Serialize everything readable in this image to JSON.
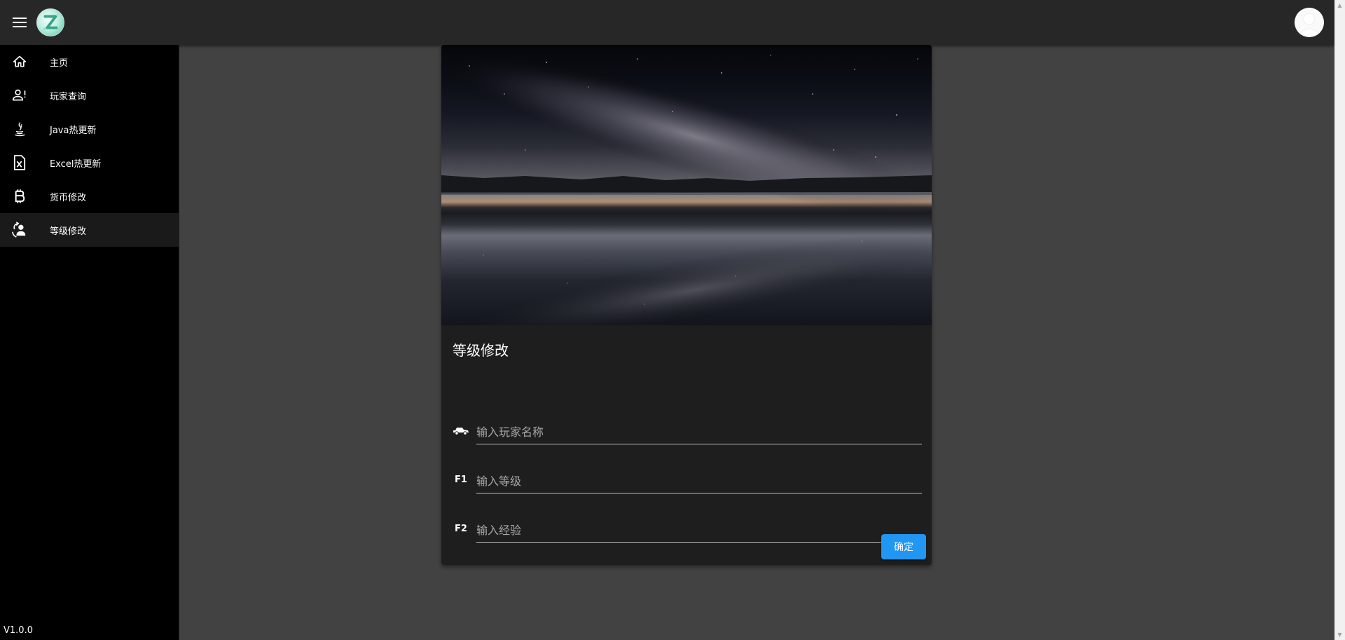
{
  "header": {
    "menu_icon": "hamburger-menu-icon",
    "logo_icon": "app-logo",
    "avatar_icon": "user-avatar"
  },
  "sidebar": {
    "items": [
      {
        "label": "主页",
        "icon": "home-icon"
      },
      {
        "label": "玩家查询",
        "icon": "account-alert-icon"
      },
      {
        "label": "Java热更新",
        "icon": "java-icon"
      },
      {
        "label": "Excel热更新",
        "icon": "excel-file-icon"
      },
      {
        "label": "货币修改",
        "icon": "bitcoin-icon"
      },
      {
        "label": "等级修改",
        "icon": "account-convert-icon"
      }
    ],
    "active_index": 5,
    "version": "V1.0.0"
  },
  "card": {
    "title": "等级修改",
    "fields": [
      {
        "icon": "car-icon",
        "icon_text": "",
        "placeholder": "输入玩家名称"
      },
      {
        "icon": "f1-key-icon",
        "icon_text": "F1",
        "placeholder": "输入等级"
      },
      {
        "icon": "f2-key-icon",
        "icon_text": "F2",
        "placeholder": "输入经验"
      }
    ],
    "confirm_label": "确定"
  },
  "colors": {
    "appbar": "#272727",
    "sidebar": "#000000",
    "background": "#424242",
    "card": "#1e1e1e",
    "primary": "#2196f3"
  }
}
